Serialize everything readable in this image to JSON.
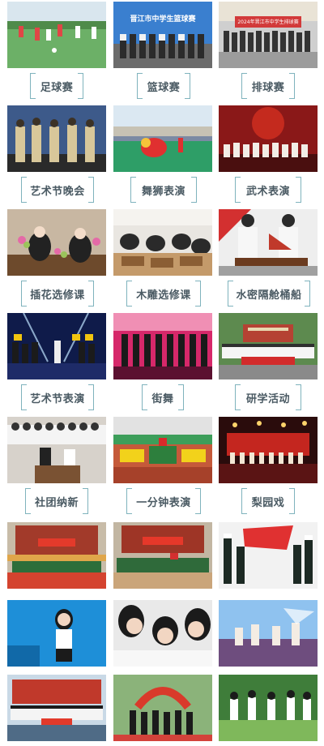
{
  "colors": {
    "label_text": "#4a5a63",
    "bracket": "#7fb3bd",
    "background": "#ffffff"
  },
  "photos": [
    {
      "caption": "足球赛",
      "overlay_text": "",
      "scene": "football-field"
    },
    {
      "caption": "篮球赛",
      "overlay_text": "晋江市中学生篮球赛",
      "scene": "basketball-team"
    },
    {
      "caption": "排球赛",
      "overlay_text": "2024年晋江市中学生排球赛",
      "scene": "volleyball-team"
    },
    {
      "caption": "艺术节晚会",
      "overlay_text": "",
      "scene": "stage-performers"
    },
    {
      "caption": "舞狮表演",
      "overlay_text": "",
      "scene": "lion-dance"
    },
    {
      "caption": "武术表演",
      "overlay_text": "",
      "scene": "martial-arts-red-stage"
    },
    {
      "caption": "插花选修课",
      "overlay_text": "",
      "scene": "flower-class"
    },
    {
      "caption": "木雕选修课",
      "overlay_text": "",
      "scene": "wood-carving-class"
    },
    {
      "caption": "水密隔舱桶船",
      "overlay_text": "",
      "scene": "boat-model"
    },
    {
      "caption": "艺术节表演",
      "overlay_text": "",
      "scene": "concert-stage"
    },
    {
      "caption": "街舞",
      "overlay_text": "",
      "scene": "street-dance"
    },
    {
      "caption": "研学活动",
      "overlay_text": "",
      "scene": "group-photo-building"
    },
    {
      "caption": "社团纳新",
      "overlay_text": "",
      "scene": "club-recruitment"
    },
    {
      "caption": "一分钟表演",
      "overlay_text": "",
      "scene": "stadium-formation"
    },
    {
      "caption": "梨园戏",
      "overlay_text": "",
      "scene": "opera-stage"
    },
    {
      "caption": "",
      "overlay_text": "",
      "scene": "graduation-building-1"
    },
    {
      "caption": "",
      "overlay_text": "",
      "scene": "graduation-building-2"
    },
    {
      "caption": "",
      "overlay_text": "",
      "scene": "flag-guard"
    },
    {
      "caption": "",
      "overlay_text": "",
      "scene": "singer-blue"
    },
    {
      "caption": "",
      "overlay_text": "",
      "scene": "students-closeup"
    },
    {
      "caption": "",
      "overlay_text": "",
      "scene": "dancers-blue"
    },
    {
      "caption": "",
      "overlay_text": "",
      "scene": "group-stage-red"
    },
    {
      "caption": "",
      "overlay_text": "",
      "scene": "gate-crowd"
    },
    {
      "caption": "",
      "overlay_text": "",
      "scene": "outdoor-students"
    }
  ]
}
